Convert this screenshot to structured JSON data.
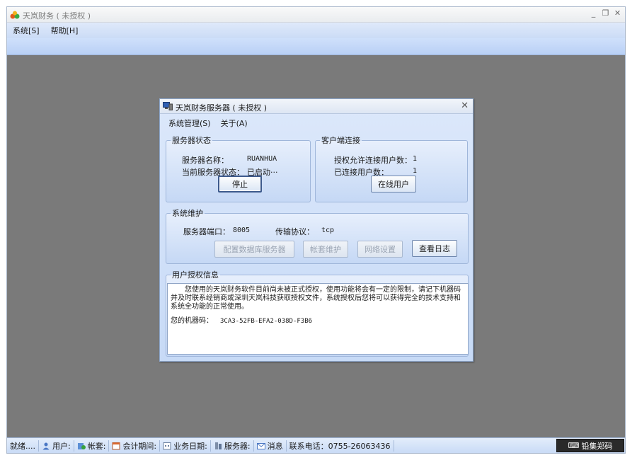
{
  "app": {
    "title": "天岚财务 ( 未授权 )",
    "menu": [
      "系统[S]",
      "帮助[H]"
    ],
    "window_controls": {
      "minimize": "_",
      "restore": "❐",
      "close": "✕"
    }
  },
  "dialog": {
    "title": "天岚财务服务器 ( 未授权 )",
    "close": "✕",
    "menu": [
      "系统管理(S)",
      "关于(A)"
    ],
    "server_status": {
      "legend": "服务器状态",
      "name_label": "服务器名称：",
      "name_value": "RUANHUA",
      "state_label": "当前服务器状态：",
      "state_value": "已启动···",
      "stop_button": "停止"
    },
    "client_connection": {
      "legend": "客户端连接",
      "allowed_label": "授权允许连接用户数：",
      "allowed_value": "1",
      "connected_label": "已连接用户数：",
      "connected_value": "1",
      "online_button": "在线用户"
    },
    "maintenance": {
      "legend": "系统维护",
      "port_label": "服务器端口：",
      "port_value": "8005",
      "protocol_label": "传输协议：",
      "protocol_value": "tcp",
      "buttons": {
        "config_db": "配置数据库服务器",
        "account_maint": "帐套维护",
        "network": "网络设置",
        "view_log": "查看日志"
      }
    },
    "license": {
      "legend": "用户授权信息",
      "text": "您使用的天岚财务软件目前尚未被正式授权，使用功能将会有一定的限制，请记下机器码并及时联系经销商或深圳天岚科技获取授权文件，系统授权后您将可以获得完全的技术支持和系统全功能的正常使用。",
      "machine_label": "您的机器码：",
      "machine_code": "3CA3-52FB-EFA2-038D-F3B6"
    }
  },
  "statusbar": {
    "ready": "就绪....",
    "user": "用户:",
    "account": "帐套:",
    "period": "会计期间:",
    "biz_date": "业务日期:",
    "server": "服务器:",
    "message": "消息",
    "phone": "联系电话：0755-26063436",
    "badge": "铅集郑码"
  },
  "colors": {
    "workspace": "#7a7a7a",
    "dialog_bg": "#c7daf6",
    "accent_border": "#8ea8cd"
  },
  "icons": [
    "app-icon",
    "server-icon",
    "user-icon",
    "account-icon",
    "calendar-icon",
    "server-small-icon",
    "message-icon",
    "ime-icon"
  ]
}
